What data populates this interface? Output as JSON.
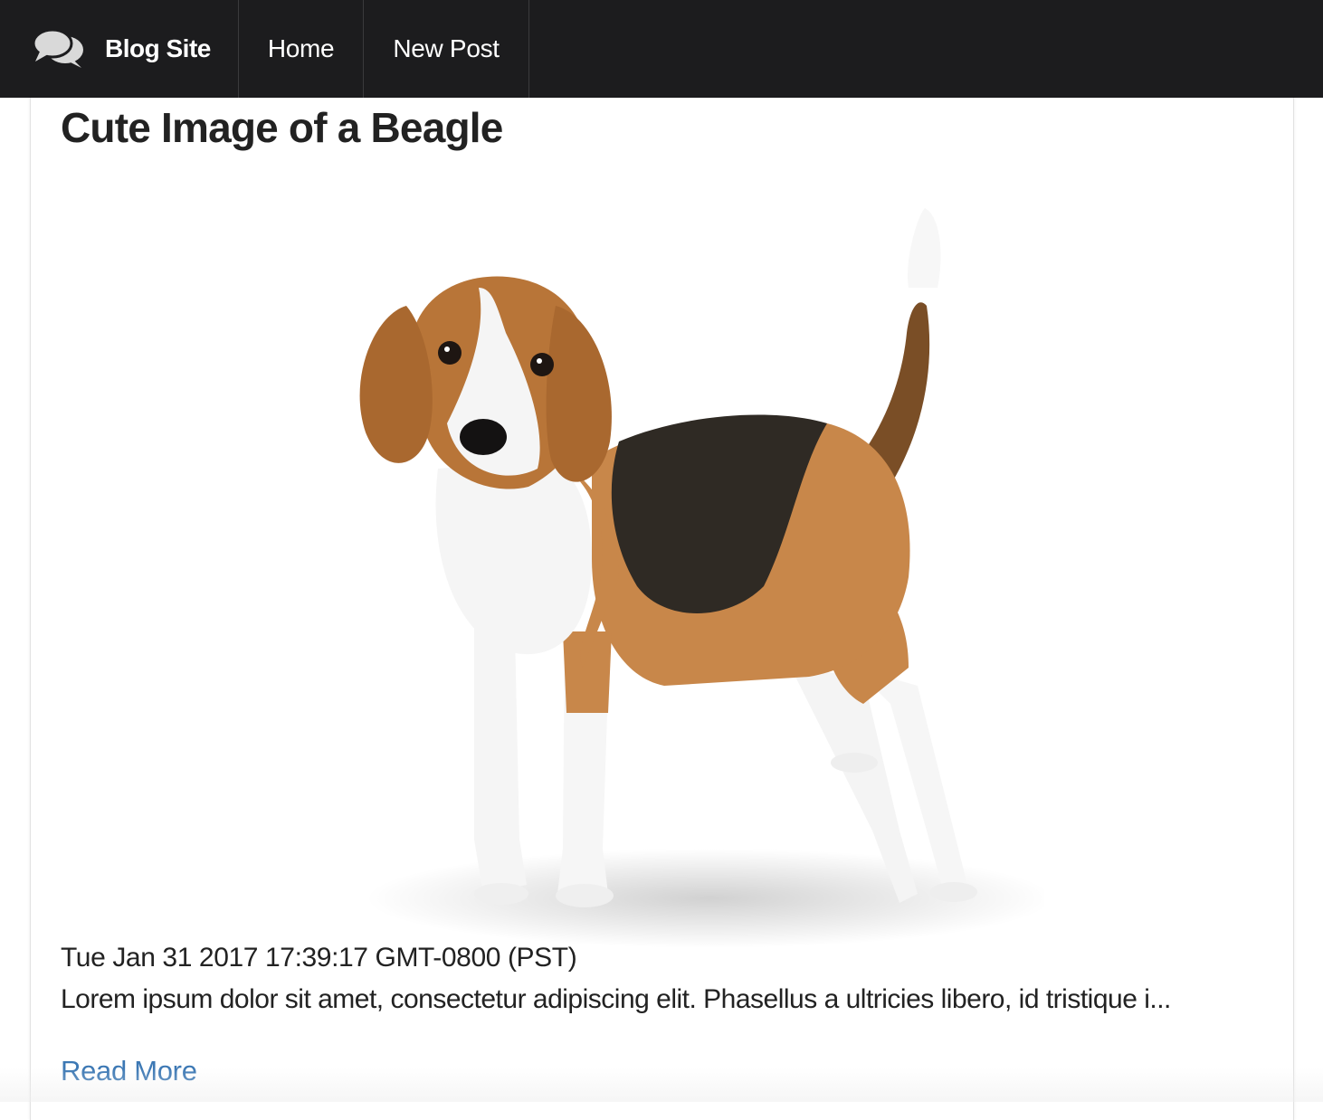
{
  "navbar": {
    "brand_icon": "speech-bubbles-icon",
    "brand_label": "Blog Site",
    "items": [
      {
        "label": "Home"
      },
      {
        "label": "New Post"
      }
    ],
    "background": "#1c1c1e"
  },
  "post": {
    "title": "Cute Image of a Beagle",
    "image_subject": "beagle-dog-photo",
    "date": "Tue Jan 31 2017 17:39:17 GMT-0800 (PST)",
    "excerpt": "Lorem ipsum dolor sit amet, consectetur adipiscing elit. Phasellus a ultricies libero, id tristique i...",
    "read_more_label": "Read More",
    "link_color": "#3c78b4"
  }
}
